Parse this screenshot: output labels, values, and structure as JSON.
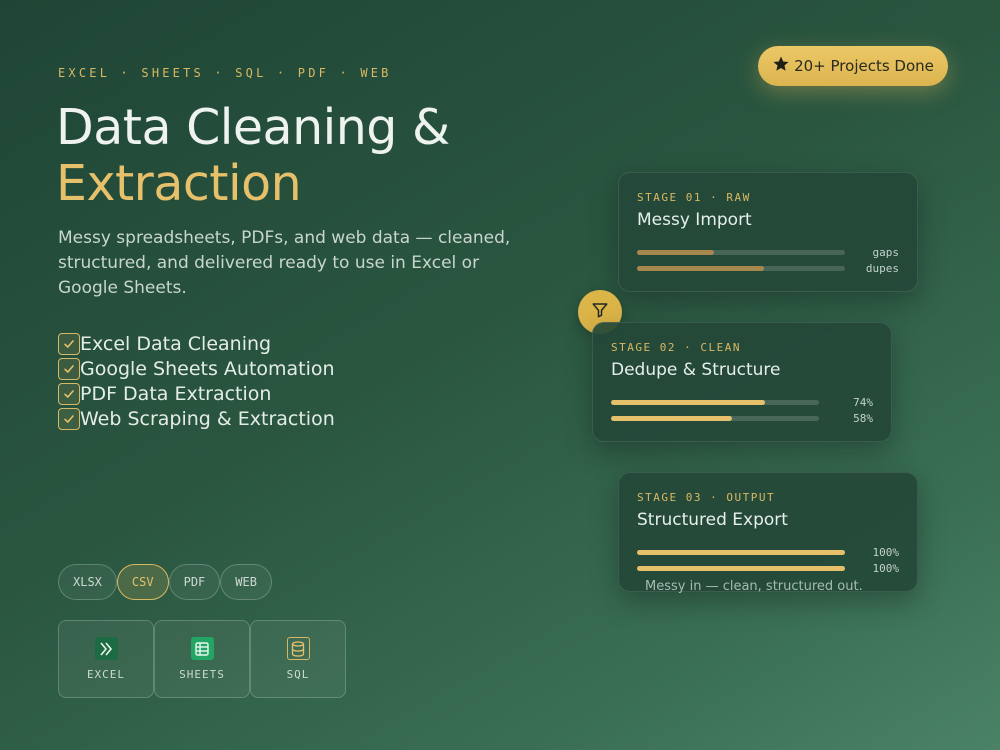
{
  "eyebrow": "EXCEL · SHEETS · SQL · PDF · WEB",
  "title": {
    "line1": "Data Cleaning &",
    "line2": "Extraction"
  },
  "subtitle": "Messy spreadsheets, PDFs, and web data — cleaned, structured, and delivered ready to use in Excel or Google Sheets.",
  "features": [
    {
      "label": "Excel Data Cleaning",
      "icon": "check-icon"
    },
    {
      "label": "Google Sheets Automation",
      "icon": "check-icon"
    },
    {
      "label": "PDF Data Extraction",
      "icon": "check-icon"
    },
    {
      "label": "Web Scraping & Extraction",
      "icon": "check-icon"
    }
  ],
  "chips": [
    {
      "label": "XLSX",
      "active": false
    },
    {
      "label": "CSV",
      "active": true
    },
    {
      "label": "PDF",
      "active": false
    },
    {
      "label": "WEB",
      "active": false
    }
  ],
  "tiles": [
    {
      "label": "EXCEL",
      "icon": "excel-icon"
    },
    {
      "label": "SHEETS",
      "icon": "sheets-icon"
    },
    {
      "label": "SQL",
      "icon": "database-icon"
    }
  ],
  "badge": {
    "label": "20+ Projects Done",
    "icon": "star-icon"
  },
  "stages": [
    {
      "stage": "STAGE 01 · RAW",
      "title": "Messy Import",
      "bars": [
        {
          "label": "gaps",
          "fill": 0.37
        },
        {
          "label": "dupes",
          "fill": 0.61
        }
      ]
    },
    {
      "stage": "STAGE 02 · CLEAN",
      "title": "Dedupe & Structure",
      "bars": [
        {
          "label": "74%",
          "fill": 0.74
        },
        {
          "label": "58%",
          "fill": 0.58
        }
      ]
    },
    {
      "stage": "STAGE 03 · OUTPUT",
      "title": "Structured Export",
      "bars": [
        {
          "label": "100%",
          "fill": 1.0
        },
        {
          "label": "100%",
          "fill": 1.0
        }
      ]
    }
  ],
  "filter_icon": "filter-icon",
  "caption": "Messy in — clean, structured out.",
  "colors": {
    "accent": "#e6c06a",
    "raw_fill": "#a8874e",
    "clean_fill": "#e6c06a",
    "excel_green": "#1d6b42",
    "sheets_green": "#23a566"
  }
}
